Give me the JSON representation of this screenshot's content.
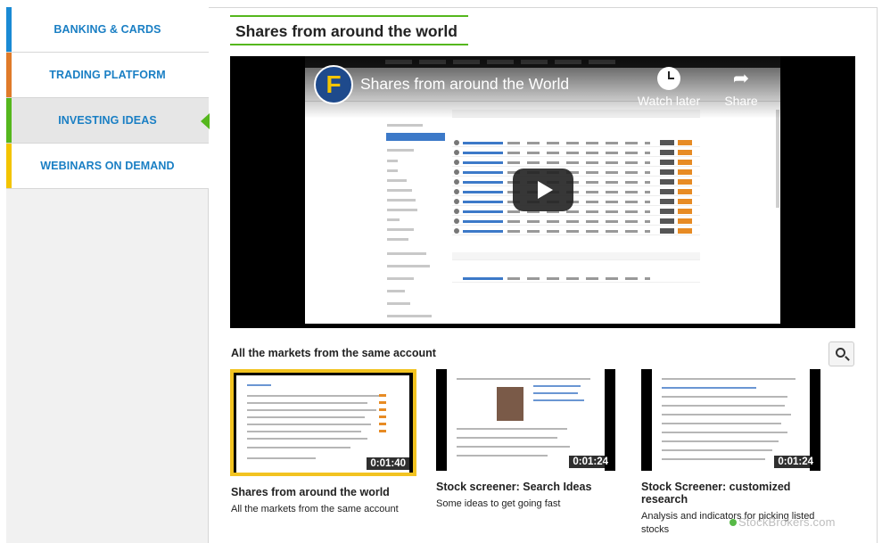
{
  "sidebar": {
    "items": [
      {
        "label": "BANKING & CARDS",
        "accent": "#1a8ad4",
        "active": false
      },
      {
        "label": "TRADING PLATFORM",
        "accent": "#e07b2a",
        "active": false
      },
      {
        "label": "INVESTING IDEAS",
        "accent": "#55b71d",
        "active": true
      },
      {
        "label": "WEBINARS ON DEMAND",
        "accent": "#f3c400",
        "active": false
      }
    ]
  },
  "main": {
    "title": "Shares from around the world",
    "video": {
      "channel_logo_letter": "F",
      "title": "Shares from around the World",
      "watch_later_label": "Watch later",
      "share_label": "Share",
      "play_icon": "play-icon"
    },
    "playlist": {
      "title": "All the markets from the same account",
      "search_icon": "search-icon",
      "items": [
        {
          "duration": "0:01:40",
          "title": "Shares from around the world",
          "description": "All the markets from the same account",
          "selected": true
        },
        {
          "duration": "0:01:24",
          "title": "Stock screener: Search Ideas",
          "description": "Some ideas to get going fast",
          "selected": false
        },
        {
          "duration": "0:01:24",
          "title": "Stock Screener: customized research",
          "description": "Analysis and indicators for picking listed stocks",
          "selected": false
        }
      ]
    }
  },
  "watermark": "StockBrokers.com",
  "colors": {
    "link": "#1a7fc4",
    "accent_green": "#55b71d",
    "selected_thumb": "#f2c320"
  }
}
